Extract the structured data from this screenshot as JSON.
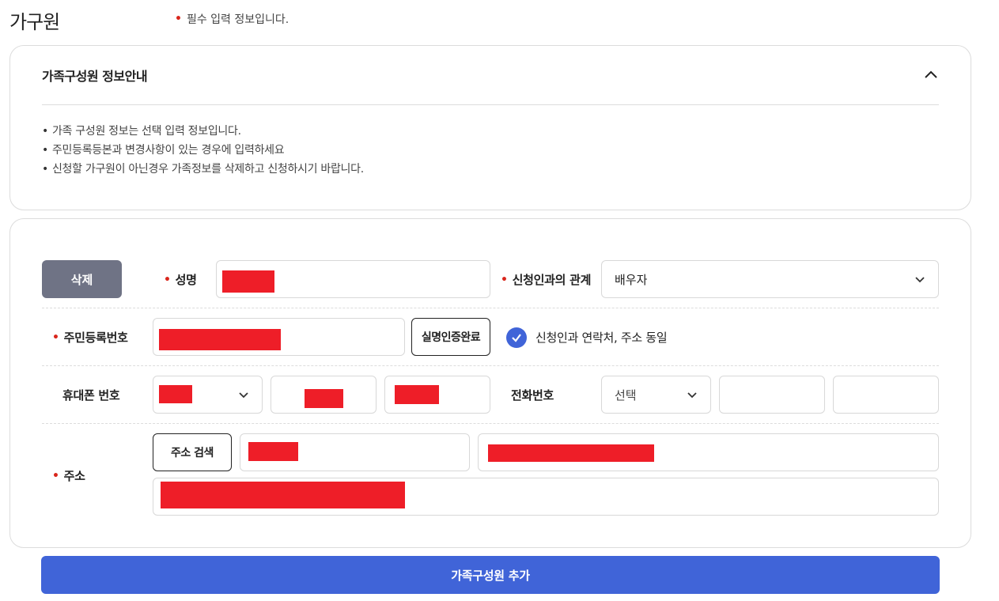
{
  "page": {
    "title": "가구원",
    "required_note": "필수 입력 정보입니다."
  },
  "info": {
    "title": "가족구성원 정보안내",
    "items": [
      "가족 구성원 정보는 선택 입력 정보입니다.",
      "주민등록등본과 변경사항이 있는 경우에 입력하세요",
      "신청할 가구원이 아닌경우 가족정보를 삭제하고 신청하시기 바랍니다."
    ]
  },
  "form": {
    "delete_label": "삭제",
    "name_label": "성명",
    "relation_label": "신청인과의 관계",
    "relation_value": "배우자",
    "rrn_label": "주민등록번호",
    "verify_label": "실명인증완료",
    "same_contact_label": "신청인과 연락처, 주소 동일",
    "same_contact_checked": true,
    "mobile_label": "휴대폰 번호",
    "tel_label": "전화번호",
    "tel_prefix_value": "선택",
    "address_label": "주소",
    "address_search_label": "주소 검색"
  },
  "add_button_label": "가족구성원 추가",
  "colors": {
    "accent": "#4064d8",
    "required_dot": "#d9261c",
    "delete_button": "#6f7385",
    "redaction": "#ee1e28"
  }
}
